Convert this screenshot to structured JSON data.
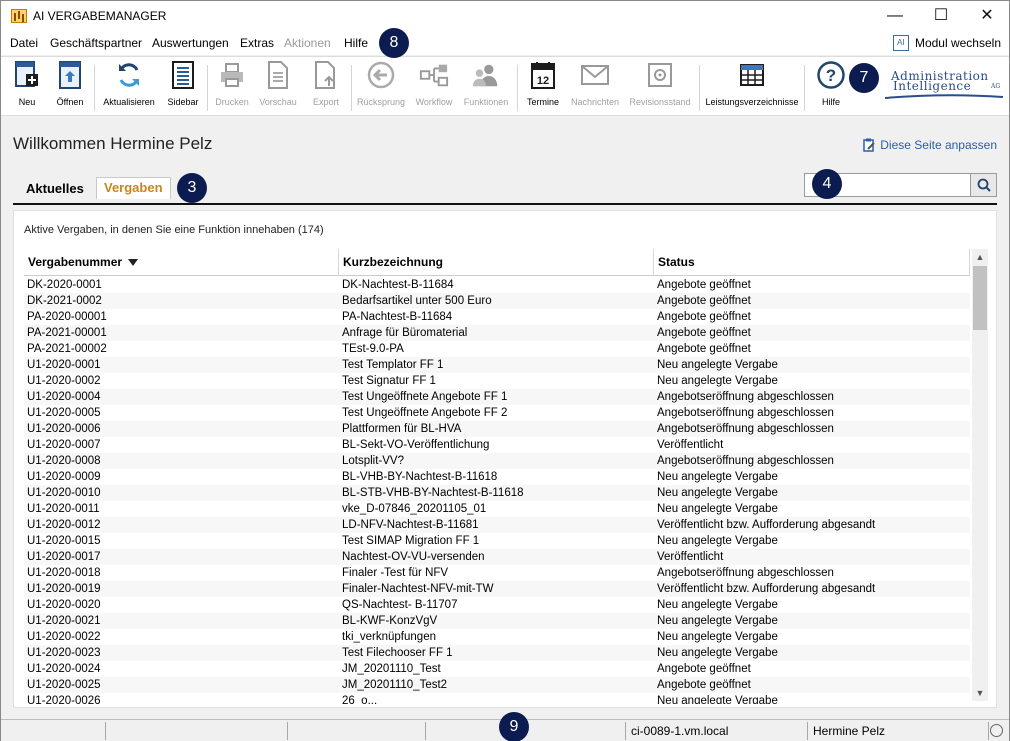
{
  "app": {
    "title": "AI VERGABEMANAGER"
  },
  "window_controls": {
    "minimize": "—",
    "maximize": "☐",
    "close": "✕"
  },
  "menu": {
    "items": [
      {
        "label": "Datei",
        "enabled": true
      },
      {
        "label": "Geschäftspartner",
        "enabled": true
      },
      {
        "label": "Auswertungen",
        "enabled": true
      },
      {
        "label": "Extras",
        "enabled": true
      },
      {
        "label": "Aktionen",
        "enabled": false
      },
      {
        "label": "Hilfe",
        "enabled": true
      }
    ],
    "modul_wechseln": "Modul wechseln"
  },
  "toolbar": {
    "buttons": [
      {
        "label": "Neu",
        "icon": "new-document-icon",
        "enabled": true
      },
      {
        "label": "Öffnen",
        "icon": "open-document-icon",
        "enabled": true
      },
      {
        "label": "Aktualisieren",
        "icon": "refresh-icon",
        "enabled": true
      },
      {
        "label": "Sidebar",
        "icon": "sidebar-icon",
        "enabled": true
      },
      {
        "label": "Drucken",
        "icon": "printer-icon",
        "enabled": false
      },
      {
        "label": "Vorschau",
        "icon": "preview-icon",
        "enabled": false
      },
      {
        "label": "Export",
        "icon": "export-icon",
        "enabled": false
      },
      {
        "label": "Rücksprung",
        "icon": "back-arrow-icon",
        "enabled": false
      },
      {
        "label": "Workflow",
        "icon": "workflow-icon",
        "enabled": false
      },
      {
        "label": "Funktionen",
        "icon": "users-icon",
        "enabled": false
      },
      {
        "label": "Termine",
        "icon": "calendar-icon",
        "enabled": true
      },
      {
        "label": "Nachrichten",
        "icon": "envelope-icon",
        "enabled": false
      },
      {
        "label": "Revisionsstand",
        "icon": "safe-icon",
        "enabled": false
      },
      {
        "label": "Leistungsverzeichnisse",
        "icon": "table-icon",
        "enabled": true
      },
      {
        "label": "Hilfe",
        "icon": "help-icon",
        "enabled": true
      }
    ]
  },
  "logo": {
    "line1": "Administration",
    "line2": "Intelligence",
    "suffix": "AG"
  },
  "badges": {
    "b3": "3",
    "b4": "4",
    "b7": "7",
    "b8": "8",
    "b9": "9"
  },
  "page": {
    "welcome": "Willkommen Hermine Pelz",
    "customize_link": "Diese Seite anpassen"
  },
  "tabs": [
    {
      "label": "Aktuelles",
      "active": false
    },
    {
      "label": "Vergaben",
      "active": true
    }
  ],
  "search": {
    "value": "",
    "placeholder": ""
  },
  "panel": {
    "caption": "Aktive Vergaben, in denen Sie eine Funktion innehaben (174)",
    "columns": [
      "Vergabenummer",
      "Kurzbezeichnung",
      "Status"
    ],
    "rows": [
      [
        "DK-2020-0001",
        "DK-Nachtest-B-11684",
        "Angebote geöffnet"
      ],
      [
        "DK-2021-0002",
        "Bedarfsartikel unter 500 Euro",
        "Angebote geöffnet"
      ],
      [
        "PA-2020-00001",
        "PA-Nachtest-B-11684",
        "Angebote geöffnet"
      ],
      [
        "PA-2021-00001",
        "Anfrage für Büromaterial",
        "Angebote geöffnet"
      ],
      [
        "PA-2021-00002",
        "TEst-9.0-PA",
        "Angebote geöffnet"
      ],
      [
        "U1-2020-0001",
        "Test Templator FF 1",
        "Neu angelegte Vergabe"
      ],
      [
        "U1-2020-0002",
        "Test Signatur FF 1",
        "Neu angelegte Vergabe"
      ],
      [
        "U1-2020-0004",
        "Test Ungeöffnete Angebote FF 1",
        "Angebotseröffnung abgeschlossen"
      ],
      [
        "U1-2020-0005",
        "Test Ungeöffnete Angebote FF 2",
        "Angebotseröffnung abgeschlossen"
      ],
      [
        "U1-2020-0006",
        "Plattformen für BL-HVA",
        "Angebotseröffnung abgeschlossen"
      ],
      [
        "U1-2020-0007",
        "BL-Sekt-VO-Veröffentlichung",
        "Veröffentlicht"
      ],
      [
        "U1-2020-0008",
        "Lotsplit-VV?",
        "Angebotseröffnung abgeschlossen"
      ],
      [
        "U1-2020-0009",
        "BL-VHB-BY-Nachtest-B-11618",
        "Neu angelegte Vergabe"
      ],
      [
        "U1-2020-0010",
        "BL-STB-VHB-BY-Nachtest-B-11618",
        "Neu angelegte Vergabe"
      ],
      [
        "U1-2020-0011",
        "vke_D-07846_20201105_01",
        "Neu angelegte Vergabe"
      ],
      [
        "U1-2020-0012",
        "LD-NFV-Nachtest-B-11681",
        "Veröffentlicht bzw. Aufforderung abgesandt"
      ],
      [
        "U1-2020-0015",
        "Test SIMAP Migration FF 1",
        "Neu angelegte Vergabe"
      ],
      [
        "U1-2020-0017",
        "Nachtest-OV-VU-versenden",
        "Veröffentlicht"
      ],
      [
        "U1-2020-0018",
        "Finaler -Test für NFV",
        "Angebotseröffnung abgeschlossen"
      ],
      [
        "U1-2020-0019",
        "Finaler-Nachtest-NFV-mit-TW",
        "Veröffentlicht bzw. Aufforderung abgesandt"
      ],
      [
        "U1-2020-0020",
        "QS-Nachtest- B-11707",
        "Neu angelegte Vergabe"
      ],
      [
        "U1-2020-0021",
        "BL-KWF-KonzVgV",
        "Neu angelegte Vergabe"
      ],
      [
        "U1-2020-0022",
        "tki_verknüpfungen",
        "Neu angelegte Vergabe"
      ],
      [
        "U1-2020-0023",
        "Test Filechooser FF 1",
        "Neu angelegte Vergabe"
      ],
      [
        "U1-2020-0024",
        "JM_20201110_Test",
        "Angebote geöffnet"
      ],
      [
        "U1-2020-0025",
        "JM_20201110_Test2",
        "Angebote geöffnet"
      ],
      [
        "U1-2020-0026",
        "26_o...",
        "Neu angelegte Vergabe"
      ]
    ]
  },
  "statusbar": {
    "host": "ci-0089-1.vm.local",
    "user": "Hermine Pelz"
  },
  "colors": {
    "accent_tab": "#c9861d",
    "link": "#2a5ea8",
    "badge": "#0c1c50"
  }
}
